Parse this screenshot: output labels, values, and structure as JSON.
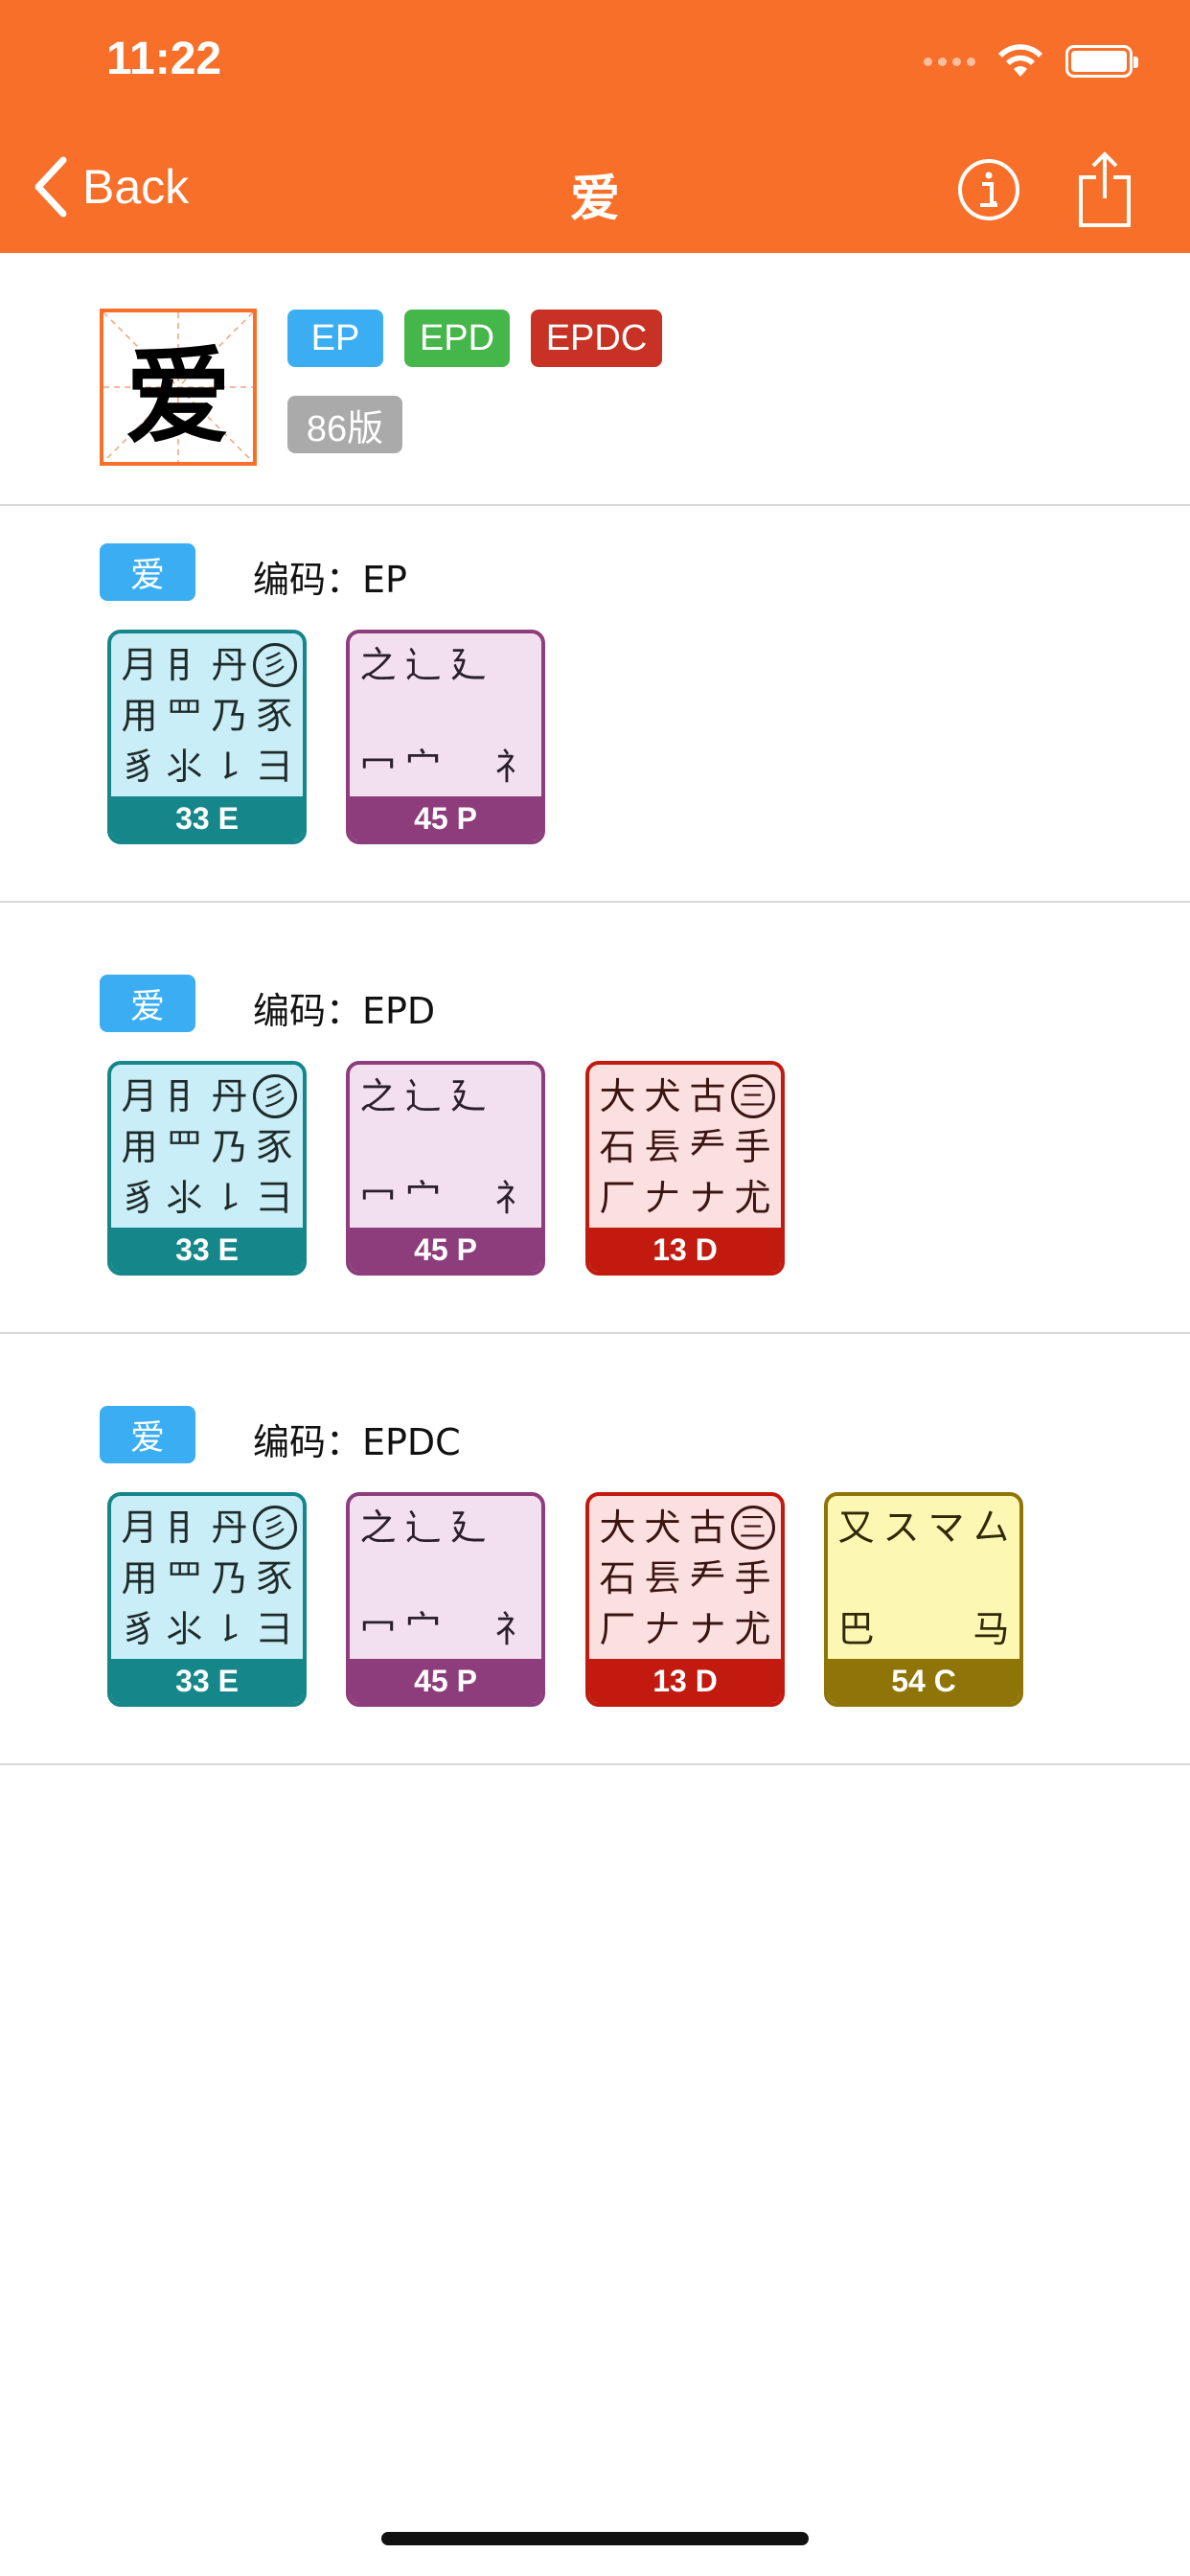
{
  "status": {
    "time": "11:22"
  },
  "nav": {
    "back_label": "Back",
    "title": "爱",
    "info_icon": "info-icon",
    "share_icon": "share-icon"
  },
  "header": {
    "character": "爱",
    "tags": {
      "ep": "EP",
      "epd": "EPD",
      "epdc": "EPDC",
      "version": "86版"
    }
  },
  "sections": [
    {
      "tag": "爱",
      "code": "编码：EP"
    },
    {
      "tag": "爱",
      "code": "编码：EPD"
    },
    {
      "tag": "爱",
      "code": "编码：EPDC"
    }
  ],
  "cards": {
    "e": {
      "roots": [
        "月",
        "⺝",
        "丹",
        "彡",
        "用",
        "罒",
        "乃",
        "豕",
        "豸",
        "⺢",
        "㇙",
        "⺕"
      ],
      "caption": "33 E"
    },
    "p": {
      "roots": [
        "之",
        "辶",
        "廴",
        "",
        "",
        "",
        "",
        "",
        "冖",
        "宀",
        "",
        "礻"
      ],
      "caption": "45 P"
    },
    "d": {
      "roots": [
        "大",
        "犬",
        "古",
        "三",
        "石",
        "镸",
        "龵",
        "手",
        "厂",
        "𠂇",
        "ナ",
        "尤"
      ],
      "caption": "13 D"
    },
    "c": {
      "roots": [
        "又",
        "ス",
        "マ",
        "厶",
        "",
        "",
        "",
        "",
        "巴",
        "",
        "",
        "马"
      ],
      "caption": "54 C"
    }
  },
  "colors": {
    "nav_bar": "#f86f2a",
    "tag_blue": "#3baef3",
    "tag_green": "#45b649",
    "tag_red": "#c73224",
    "tag_gray": "#aaaaaa",
    "card_e": "#15868a",
    "card_p": "#8d3d7c",
    "card_d": "#c31a10",
    "card_c": "#8f7508"
  }
}
